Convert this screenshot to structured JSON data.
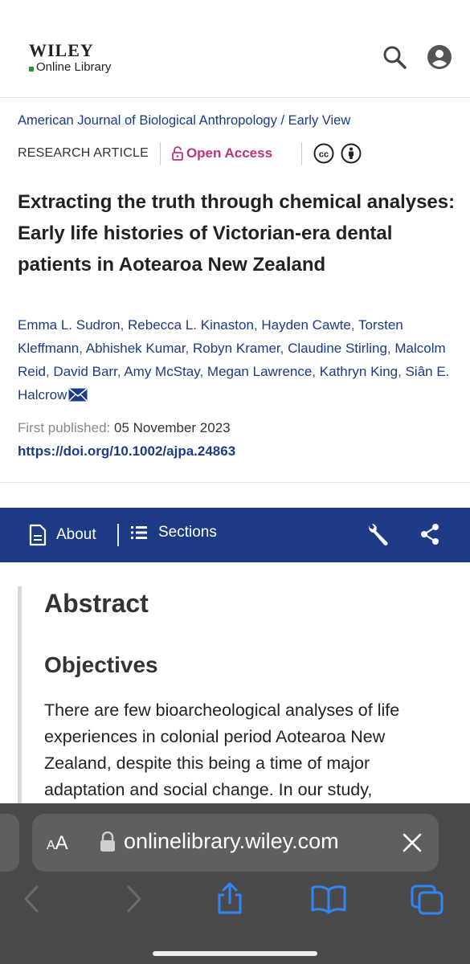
{
  "header": {
    "logo_top": "WILEY",
    "logo_bottom": "Online Library"
  },
  "article": {
    "journal_line": "American Journal of Biological Anthropology / Early View",
    "type": "RESEARCH ARTICLE",
    "access": "Open Access",
    "title": "Extracting the truth through chemical analyses: Early life histories of Victorian-era dental patients in Aotearoa New Zealand",
    "authors": [
      "Emma L. Sudron",
      "Rebecca L. Kinaston",
      "Hayden Cawte",
      "Torsten Kleffmann",
      "Abhishek Kumar",
      "Robyn Kramer",
      "Claudine Stirling",
      "Malcolm Reid",
      "David Barr",
      "Amy McStay",
      "Megan Lawrence",
      "Kathryn King",
      "Siân E. Halcrow"
    ],
    "first_published_label": "First published:",
    "first_published_date": "05 November 2023",
    "doi": "https://doi.org/10.1002/ajpa.24863"
  },
  "toolbar": {
    "about": "About",
    "sections": "Sections"
  },
  "abstract": {
    "heading": "Abstract",
    "subheading": "Objectives",
    "text": "There are few bioarcheological analyses of life experiences in colonial period Aotearoa New Zealand, despite this being a time of major adaptation and social change. In our study,"
  },
  "browser": {
    "aa_small": "A",
    "aa_big": "A",
    "url": "onlinelibrary.wiley.com"
  },
  "colors": {
    "brand_blue": "#1d3b85",
    "open_access_pink": "#b9357f",
    "safari_bg": "#4a4a4c"
  }
}
